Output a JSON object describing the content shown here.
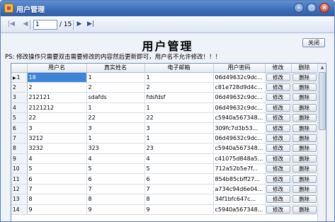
{
  "window": {
    "title": "用户管理"
  },
  "navigator": {
    "current_page": "1",
    "total_pages": "/ 15",
    "icons": [
      "first-page-icon",
      "prev-page-icon",
      "next-page-icon",
      "last-page-icon"
    ]
  },
  "header": {
    "page_title": "用户管理",
    "close_label": "关闭",
    "notice": "PS: 修改操作只需要双击需要修改的内容然后更新即可，用户名不允许修改！！！"
  },
  "grid": {
    "columns": [
      "用户名",
      "真实姓名",
      "电子邮箱",
      "用户密码",
      "修改",
      "删除"
    ],
    "selected_row": 0,
    "rows": [
      {
        "id": "1",
        "username": "18",
        "realname": "1",
        "email": "1",
        "password": "06d49632c9dc...",
        "edit": "修改",
        "delete": "删除"
      },
      {
        "id": "2",
        "username": "2",
        "realname": "2",
        "email": "2",
        "password": "c81e728d9d4c...",
        "edit": "修改",
        "delete": "删除"
      },
      {
        "id": "3",
        "username": "212121",
        "realname": "sdafds",
        "email": "fdsfdsf",
        "password": "06d49632c9dc...",
        "edit": "修改",
        "delete": "删除"
      },
      {
        "id": "4",
        "username": "2121212",
        "realname": "1",
        "email": "1",
        "password": "06d49632c9dc...",
        "edit": "修改",
        "delete": "删除"
      },
      {
        "id": "5",
        "username": "22",
        "realname": "22",
        "email": "22",
        "password": "c5940a567348...",
        "edit": "修改",
        "delete": "删除"
      },
      {
        "id": "6",
        "username": "3",
        "realname": "3",
        "email": "3",
        "password": "309fc7d3b53...",
        "edit": "修改",
        "delete": "删除"
      },
      {
        "id": "7",
        "username": "3212",
        "realname": "1",
        "email": "1",
        "password": "06d49632c9dc...",
        "edit": "修改",
        "delete": "删除"
      },
      {
        "id": "8",
        "username": "3232",
        "realname": "323",
        "email": "23",
        "password": "c5940a567348...",
        "edit": "修改",
        "delete": "删除"
      },
      {
        "id": "9",
        "username": "4",
        "realname": "4",
        "email": "4",
        "password": "c41075d848a5...",
        "edit": "修改",
        "delete": "删除"
      },
      {
        "id": "10",
        "username": "5",
        "realname": "5",
        "email": "5",
        "password": "712a52b5e7f...",
        "edit": "修改",
        "delete": "删除"
      },
      {
        "id": "11",
        "username": "6",
        "realname": "6",
        "email": "6",
        "password": "854b85cbff27...",
        "edit": "修改",
        "delete": "删除"
      },
      {
        "id": "12",
        "username": "7",
        "realname": "7",
        "email": "7",
        "password": "a734c94d6e04...",
        "edit": "修改",
        "delete": "删除"
      },
      {
        "id": "13",
        "username": "8",
        "realname": "8",
        "email": "8",
        "password": "34f1bfc647c...",
        "edit": "修改",
        "delete": "删除"
      },
      {
        "id": "14",
        "username": "9",
        "realname": "9",
        "email": "9",
        "password": "c5940a567348...",
        "edit": "修改",
        "delete": "删除"
      }
    ]
  }
}
